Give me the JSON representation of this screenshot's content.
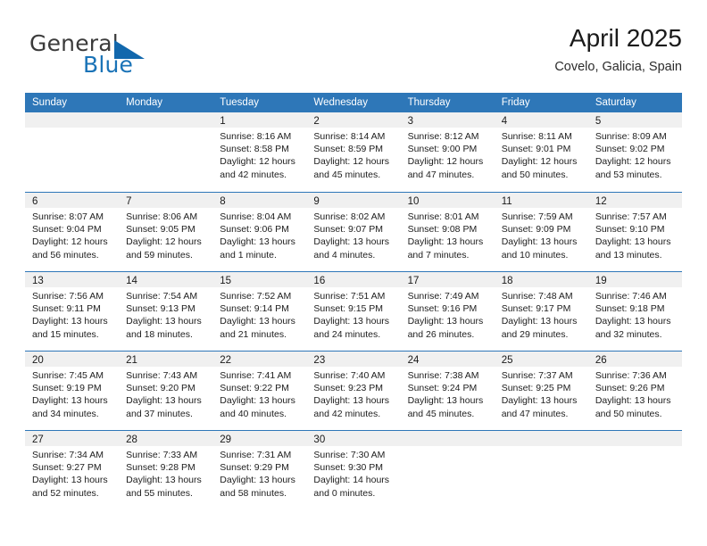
{
  "brand": {
    "name_part1": "General",
    "name_part2": "Blue",
    "flag_icon": "triangle-flag-icon"
  },
  "header": {
    "title": "April 2025",
    "subtitle": "Covelo, Galicia, Spain"
  },
  "colors": {
    "header_blue": "#2e77b8",
    "brand_blue": "#1a73b7",
    "daynum_band": "#f0f0f0",
    "text": "#202020"
  },
  "weekdays": [
    "Sunday",
    "Monday",
    "Tuesday",
    "Wednesday",
    "Thursday",
    "Friday",
    "Saturday"
  ],
  "weeks": [
    [
      {
        "day": "",
        "sunrise": "",
        "sunset": "",
        "daylight_line1": "",
        "daylight_line2": ""
      },
      {
        "day": "",
        "sunrise": "",
        "sunset": "",
        "daylight_line1": "",
        "daylight_line2": ""
      },
      {
        "day": "1",
        "sunrise": "Sunrise: 8:16 AM",
        "sunset": "Sunset: 8:58 PM",
        "daylight_line1": "Daylight: 12 hours",
        "daylight_line2": "and 42 minutes."
      },
      {
        "day": "2",
        "sunrise": "Sunrise: 8:14 AM",
        "sunset": "Sunset: 8:59 PM",
        "daylight_line1": "Daylight: 12 hours",
        "daylight_line2": "and 45 minutes."
      },
      {
        "day": "3",
        "sunrise": "Sunrise: 8:12 AM",
        "sunset": "Sunset: 9:00 PM",
        "daylight_line1": "Daylight: 12 hours",
        "daylight_line2": "and 47 minutes."
      },
      {
        "day": "4",
        "sunrise": "Sunrise: 8:11 AM",
        "sunset": "Sunset: 9:01 PM",
        "daylight_line1": "Daylight: 12 hours",
        "daylight_line2": "and 50 minutes."
      },
      {
        "day": "5",
        "sunrise": "Sunrise: 8:09 AM",
        "sunset": "Sunset: 9:02 PM",
        "daylight_line1": "Daylight: 12 hours",
        "daylight_line2": "and 53 minutes."
      }
    ],
    [
      {
        "day": "6",
        "sunrise": "Sunrise: 8:07 AM",
        "sunset": "Sunset: 9:04 PM",
        "daylight_line1": "Daylight: 12 hours",
        "daylight_line2": "and 56 minutes."
      },
      {
        "day": "7",
        "sunrise": "Sunrise: 8:06 AM",
        "sunset": "Sunset: 9:05 PM",
        "daylight_line1": "Daylight: 12 hours",
        "daylight_line2": "and 59 minutes."
      },
      {
        "day": "8",
        "sunrise": "Sunrise: 8:04 AM",
        "sunset": "Sunset: 9:06 PM",
        "daylight_line1": "Daylight: 13 hours",
        "daylight_line2": "and 1 minute."
      },
      {
        "day": "9",
        "sunrise": "Sunrise: 8:02 AM",
        "sunset": "Sunset: 9:07 PM",
        "daylight_line1": "Daylight: 13 hours",
        "daylight_line2": "and 4 minutes."
      },
      {
        "day": "10",
        "sunrise": "Sunrise: 8:01 AM",
        "sunset": "Sunset: 9:08 PM",
        "daylight_line1": "Daylight: 13 hours",
        "daylight_line2": "and 7 minutes."
      },
      {
        "day": "11",
        "sunrise": "Sunrise: 7:59 AM",
        "sunset": "Sunset: 9:09 PM",
        "daylight_line1": "Daylight: 13 hours",
        "daylight_line2": "and 10 minutes."
      },
      {
        "day": "12",
        "sunrise": "Sunrise: 7:57 AM",
        "sunset": "Sunset: 9:10 PM",
        "daylight_line1": "Daylight: 13 hours",
        "daylight_line2": "and 13 minutes."
      }
    ],
    [
      {
        "day": "13",
        "sunrise": "Sunrise: 7:56 AM",
        "sunset": "Sunset: 9:11 PM",
        "daylight_line1": "Daylight: 13 hours",
        "daylight_line2": "and 15 minutes."
      },
      {
        "day": "14",
        "sunrise": "Sunrise: 7:54 AM",
        "sunset": "Sunset: 9:13 PM",
        "daylight_line1": "Daylight: 13 hours",
        "daylight_line2": "and 18 minutes."
      },
      {
        "day": "15",
        "sunrise": "Sunrise: 7:52 AM",
        "sunset": "Sunset: 9:14 PM",
        "daylight_line1": "Daylight: 13 hours",
        "daylight_line2": "and 21 minutes."
      },
      {
        "day": "16",
        "sunrise": "Sunrise: 7:51 AM",
        "sunset": "Sunset: 9:15 PM",
        "daylight_line1": "Daylight: 13 hours",
        "daylight_line2": "and 24 minutes."
      },
      {
        "day": "17",
        "sunrise": "Sunrise: 7:49 AM",
        "sunset": "Sunset: 9:16 PM",
        "daylight_line1": "Daylight: 13 hours",
        "daylight_line2": "and 26 minutes."
      },
      {
        "day": "18",
        "sunrise": "Sunrise: 7:48 AM",
        "sunset": "Sunset: 9:17 PM",
        "daylight_line1": "Daylight: 13 hours",
        "daylight_line2": "and 29 minutes."
      },
      {
        "day": "19",
        "sunrise": "Sunrise: 7:46 AM",
        "sunset": "Sunset: 9:18 PM",
        "daylight_line1": "Daylight: 13 hours",
        "daylight_line2": "and 32 minutes."
      }
    ],
    [
      {
        "day": "20",
        "sunrise": "Sunrise: 7:45 AM",
        "sunset": "Sunset: 9:19 PM",
        "daylight_line1": "Daylight: 13 hours",
        "daylight_line2": "and 34 minutes."
      },
      {
        "day": "21",
        "sunrise": "Sunrise: 7:43 AM",
        "sunset": "Sunset: 9:20 PM",
        "daylight_line1": "Daylight: 13 hours",
        "daylight_line2": "and 37 minutes."
      },
      {
        "day": "22",
        "sunrise": "Sunrise: 7:41 AM",
        "sunset": "Sunset: 9:22 PM",
        "daylight_line1": "Daylight: 13 hours",
        "daylight_line2": "and 40 minutes."
      },
      {
        "day": "23",
        "sunrise": "Sunrise: 7:40 AM",
        "sunset": "Sunset: 9:23 PM",
        "daylight_line1": "Daylight: 13 hours",
        "daylight_line2": "and 42 minutes."
      },
      {
        "day": "24",
        "sunrise": "Sunrise: 7:38 AM",
        "sunset": "Sunset: 9:24 PM",
        "daylight_line1": "Daylight: 13 hours",
        "daylight_line2": "and 45 minutes."
      },
      {
        "day": "25",
        "sunrise": "Sunrise: 7:37 AM",
        "sunset": "Sunset: 9:25 PM",
        "daylight_line1": "Daylight: 13 hours",
        "daylight_line2": "and 47 minutes."
      },
      {
        "day": "26",
        "sunrise": "Sunrise: 7:36 AM",
        "sunset": "Sunset: 9:26 PM",
        "daylight_line1": "Daylight: 13 hours",
        "daylight_line2": "and 50 minutes."
      }
    ],
    [
      {
        "day": "27",
        "sunrise": "Sunrise: 7:34 AM",
        "sunset": "Sunset: 9:27 PM",
        "daylight_line1": "Daylight: 13 hours",
        "daylight_line2": "and 52 minutes."
      },
      {
        "day": "28",
        "sunrise": "Sunrise: 7:33 AM",
        "sunset": "Sunset: 9:28 PM",
        "daylight_line1": "Daylight: 13 hours",
        "daylight_line2": "and 55 minutes."
      },
      {
        "day": "29",
        "sunrise": "Sunrise: 7:31 AM",
        "sunset": "Sunset: 9:29 PM",
        "daylight_line1": "Daylight: 13 hours",
        "daylight_line2": "and 58 minutes."
      },
      {
        "day": "30",
        "sunrise": "Sunrise: 7:30 AM",
        "sunset": "Sunset: 9:30 PM",
        "daylight_line1": "Daylight: 14 hours",
        "daylight_line2": "and 0 minutes."
      },
      {
        "day": "",
        "sunrise": "",
        "sunset": "",
        "daylight_line1": "",
        "daylight_line2": ""
      },
      {
        "day": "",
        "sunrise": "",
        "sunset": "",
        "daylight_line1": "",
        "daylight_line2": ""
      },
      {
        "day": "",
        "sunrise": "",
        "sunset": "",
        "daylight_line1": "",
        "daylight_line2": ""
      }
    ]
  ]
}
